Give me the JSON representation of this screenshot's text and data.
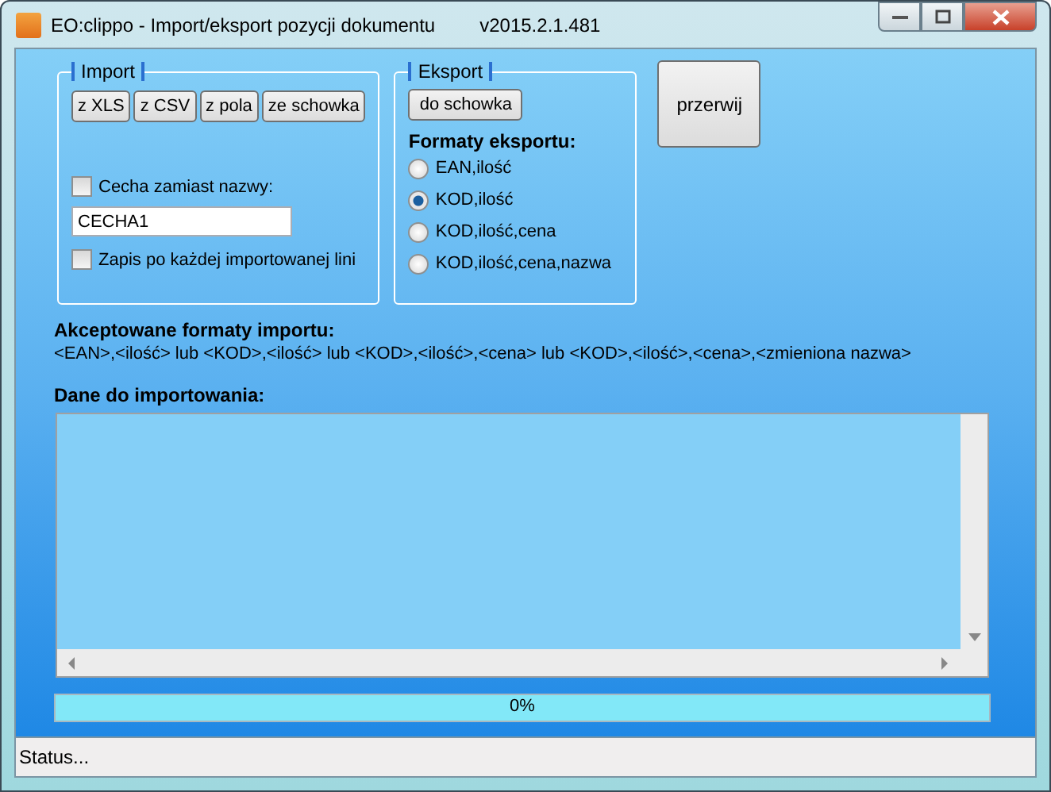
{
  "window": {
    "title": "EO:clippo - Import/eksport pozycji dokumentu",
    "version": "v2015.2.1.481"
  },
  "import_group": {
    "title": "Import",
    "buttons": [
      "z XLS",
      "z CSV",
      "z pola",
      "ze schowka"
    ],
    "feature_checkbox": {
      "label": "Cecha zamiast nazwy:",
      "checked": false
    },
    "feature_field": {
      "value": "CECHA1"
    },
    "save_checkbox": {
      "label": "Zapis po każdej importowanej lini",
      "checked": false
    }
  },
  "export_group": {
    "title": "Eksport",
    "button": "do schowka",
    "formats_label": "Formaty eksportu:",
    "formats": [
      {
        "label": "EAN,ilość",
        "selected": false
      },
      {
        "label": "KOD,ilość",
        "selected": true
      },
      {
        "label": "KOD,ilość,cena",
        "selected": false
      },
      {
        "label": "KOD,ilość,cena,nazwa",
        "selected": false
      }
    ]
  },
  "stop_button": "przerwij",
  "accepted_formats": {
    "label": "Akceptowane formaty importu:",
    "text": "<EAN>,<ilość>   lub  <KOD>,<ilość> lub <KOD>,<ilość>,<cena> lub <KOD>,<ilość>,<cena>,<zmieniona nazwa>"
  },
  "import_data": {
    "label": "Dane do importowania:"
  },
  "progress": {
    "level": 0,
    "reading": "0%"
  },
  "status_bar": "Status..."
}
